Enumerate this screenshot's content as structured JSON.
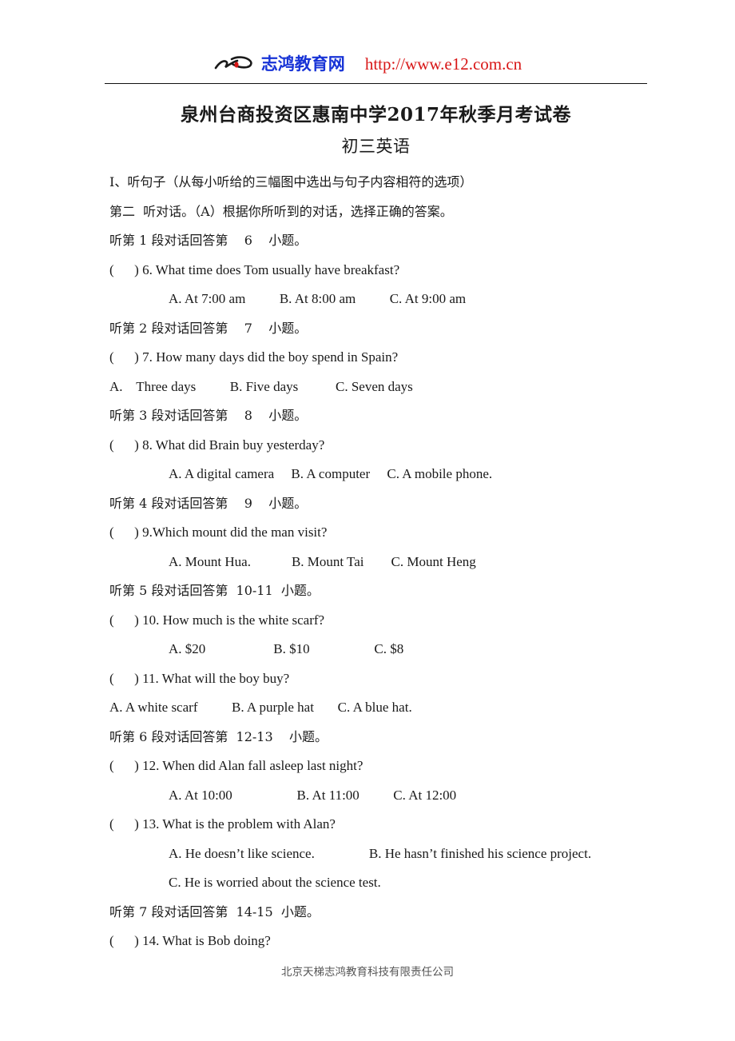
{
  "header": {
    "brand_mark_icon": "brush-stroke-logo-icon",
    "brand_name": "志鸿教育网",
    "url": "http://www.e12.com.cn",
    "brand_color": "#1733d6",
    "url_color": "#d81616"
  },
  "title": "泉州台商投资区惠南中学2017年秋季月考试卷",
  "subtitle": "初三英语",
  "lines": [
    {
      "text": "I、听句子（从每小听给的三幅图中选出与句子内容相符的选项）",
      "lang": "cn",
      "indent": false
    },
    {
      "text": "第二  听对话。（A）根据你所听到的对话，选择正确的答案。",
      "lang": "cn",
      "indent": false
    },
    {
      "text": "听第 1 段对话回答第    6    小题。",
      "lang": "cn",
      "indent": false
    },
    {
      "text": "(      ) 6. What time does Tom usually have breakfast?",
      "lang": "en",
      "indent": false
    },
    {
      "text": "A. At 7:00 am          B. At 8:00 am          C. At 9:00 am",
      "lang": "en",
      "indent": true
    },
    {
      "text": "听第 2 段对话回答第    7    小题。",
      "lang": "cn",
      "indent": false
    },
    {
      "text": "(      ) 7. How many days did the boy spend in Spain?",
      "lang": "en",
      "indent": false
    },
    {
      "text": "A.    Three days          B. Five days           C. Seven days",
      "lang": "en",
      "indent": false
    },
    {
      "text": "听第 3 段对话回答第    8    小题。",
      "lang": "cn",
      "indent": false
    },
    {
      "text": "(      ) 8. What did Brain buy yesterday?",
      "lang": "en",
      "indent": false
    },
    {
      "text": "A. A digital camera     B. A computer     C. A mobile phone.",
      "lang": "en",
      "indent": true
    },
    {
      "text": "听第 4 段对话回答第    9    小题。",
      "lang": "cn",
      "indent": false
    },
    {
      "text": "(      ) 9.Which mount did the man visit?",
      "lang": "en",
      "indent": false
    },
    {
      "text": "A. Mount Hua.            B. Mount Tai        C. Mount Heng",
      "lang": "en",
      "indent": true
    },
    {
      "text": "听第 5 段对话回答第  10-11  小题。",
      "lang": "cn",
      "indent": false
    },
    {
      "text": "(      ) 10. How much is the white scarf?",
      "lang": "en",
      "indent": false
    },
    {
      "text": "A. $20                    B. $10                   C. $8",
      "lang": "en",
      "indent": true
    },
    {
      "text": "(      ) 11. What will the boy buy?",
      "lang": "en",
      "indent": false
    },
    {
      "text": "A. A white scarf          B. A purple hat       C. A blue hat.",
      "lang": "en",
      "indent": false
    },
    {
      "text": "听第 6 段对话回答第  12-13    小题。",
      "lang": "cn",
      "indent": false
    },
    {
      "text": "(      ) 12. When did Alan fall asleep last night?",
      "lang": "en",
      "indent": false
    },
    {
      "text": "A. At 10:00                   B. At 11:00          C. At 12:00",
      "lang": "en",
      "indent": true
    },
    {
      "text": "(      ) 13. What is the problem with Alan?",
      "lang": "en",
      "indent": false
    },
    {
      "text": "A. He doesn’t like science.                B. He hasn’t finished his science project.",
      "lang": "en",
      "indent": true
    },
    {
      "text": "C. He is worried about the science test.",
      "lang": "en",
      "indent": true
    },
    {
      "text": "听第 7 段对话回答第  14-15  小题。",
      "lang": "cn",
      "indent": false
    },
    {
      "text": "(      ) 14. What is Bob doing?",
      "lang": "en",
      "indent": false
    }
  ],
  "footer": "北京天梯志鸿教育科技有限责任公司"
}
